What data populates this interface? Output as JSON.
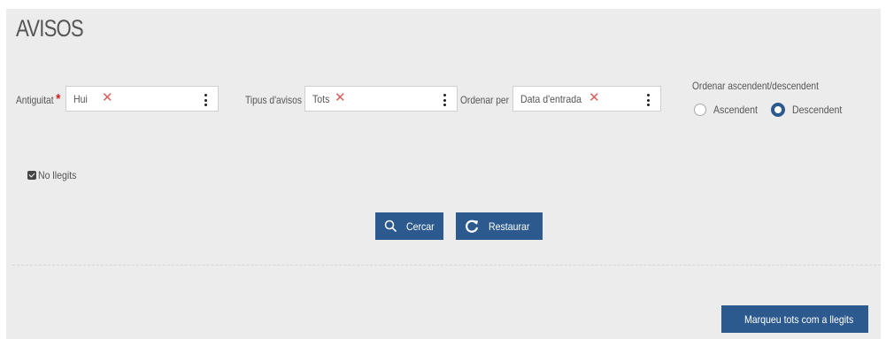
{
  "page": {
    "title": "AVISOS"
  },
  "filters": {
    "antiguitat": {
      "label": "Antiguitat",
      "required_mark": "*",
      "value": "Hui"
    },
    "tipus": {
      "label": "Tipus d'avisos",
      "value": "Tots"
    },
    "ordenar_per": {
      "label": "Ordenar per",
      "value": "Data d'entrada"
    },
    "ordre": {
      "label": "Ordenar ascendent/descendent",
      "options": [
        {
          "label": "Ascendent",
          "selected": false
        },
        {
          "label": "Descendent",
          "selected": true
        }
      ]
    },
    "no_llegits": {
      "label": "No llegits",
      "checked": true
    }
  },
  "actions": {
    "cercar": "Cercar",
    "restaurar": "Restaurar",
    "marcar_llegits": "Marqueu tots com a llegits"
  },
  "icons": {
    "clear": "close-icon",
    "more": "vertical-dots-icon",
    "search": "search-icon",
    "refresh": "refresh-icon",
    "check": "check-icon"
  },
  "colors": {
    "primary": "#2c5a8f",
    "clear_x": "#e05a5a",
    "required": "#cc2222",
    "panel": "#ececec"
  }
}
